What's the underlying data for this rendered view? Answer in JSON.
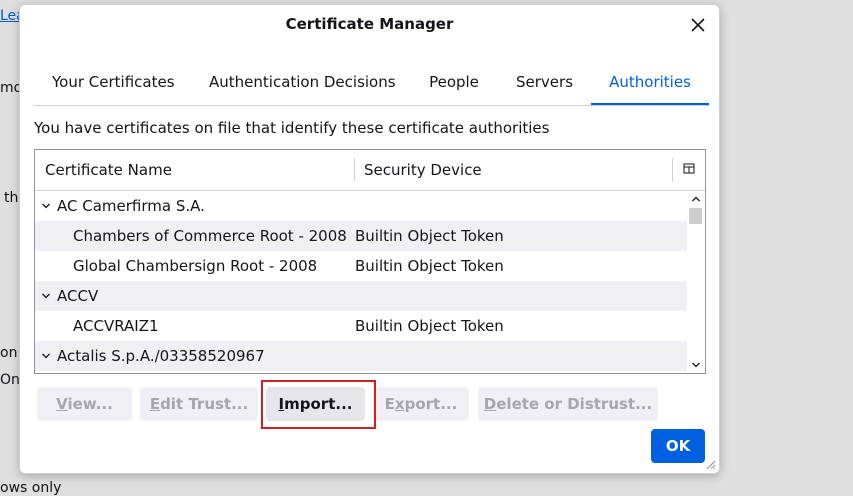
{
  "background": {
    "fragments": [
      "Lea",
      "mo",
      "th",
      "on",
      "On",
      "ows only"
    ]
  },
  "dialog": {
    "title": "Certificate Manager",
    "tabs": [
      {
        "label": "Your Certificates"
      },
      {
        "label": "Authentication Decisions"
      },
      {
        "label": "People"
      },
      {
        "label": "Servers"
      },
      {
        "label": "Authorities",
        "active": true
      }
    ],
    "description": "You have certificates on file that identify these certificate authorities",
    "columns": {
      "name": "Certificate Name",
      "device": "Security Device"
    },
    "rows": [
      {
        "type": "group",
        "name": "AC Camerfirma S.A.",
        "device": ""
      },
      {
        "type": "item",
        "name": "Chambers of Commerce Root - 2008",
        "device": "Builtin Object Token"
      },
      {
        "type": "item",
        "name": "Global Chambersign Root - 2008",
        "device": "Builtin Object Token"
      },
      {
        "type": "group",
        "name": "ACCV",
        "device": ""
      },
      {
        "type": "item",
        "name": "ACCVRAIZ1",
        "device": "Builtin Object Token"
      },
      {
        "type": "group",
        "name": "Actalis S.p.A./03358520967",
        "device": ""
      }
    ],
    "buttons": {
      "view": {
        "prefix": "",
        "key": "V",
        "suffix": "iew...",
        "enabled": false
      },
      "edit_trust": {
        "prefix": "",
        "key": "E",
        "suffix": "dit Trust...",
        "enabled": false
      },
      "import": {
        "prefix": "",
        "key": "I",
        "suffix": "mport...",
        "enabled": true
      },
      "export": {
        "prefix": "E",
        "key": "x",
        "suffix": "port...",
        "enabled": false
      },
      "delete": {
        "prefix": "",
        "key": "D",
        "suffix": "elete or Distrust...",
        "enabled": false
      }
    },
    "ok_label": "OK"
  },
  "colors": {
    "accent": "#0061e0",
    "highlight_box": "#d21f1f",
    "disabled_text": "#a5a5ad"
  },
  "icons": {
    "close": "close-icon",
    "column_picker": "column-picker-icon",
    "twisty": "chevron-down-icon",
    "scroll_up": "scroll-up-arrow-icon",
    "scroll_down": "scroll-down-arrow-icon",
    "resize": "resize-grip-icon"
  }
}
